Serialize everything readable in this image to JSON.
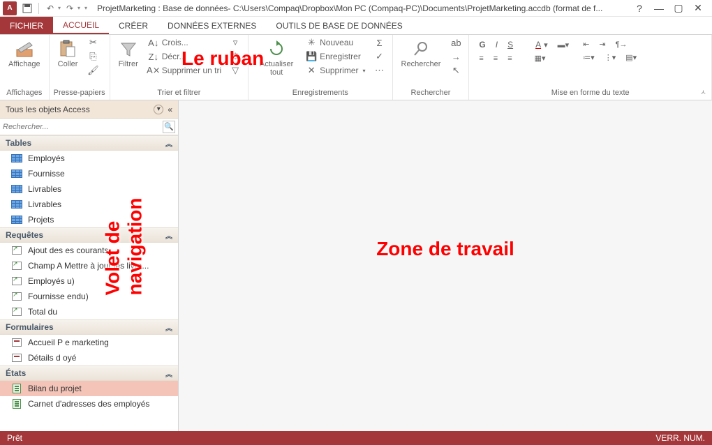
{
  "title": "ProjetMarketing : Base de données- C:\\Users\\Compaq\\Dropbox\\Mon PC (Compaq-PC)\\Documents\\ProjetMarketing.accdb (format de f...",
  "app_icon_letter": "A",
  "tabs": {
    "file": "FICHIER",
    "home": "ACCUEIL",
    "create": "CRÉER",
    "external": "DONNÉES EXTERNES",
    "dbtools": "OUTILS DE BASE DE DONNÉES"
  },
  "ribbon": {
    "views": {
      "label": "Affichages",
      "btn": "Affichage"
    },
    "clipboard": {
      "label": "Presse-papiers",
      "paste": "Coller"
    },
    "sortfilter": {
      "label": "Trier et filtrer",
      "filter": "Filtrer",
      "asc": "Crois...",
      "desc": "Décr...",
      "clear": "Supprimer un tri"
    },
    "records": {
      "label": "Enregistrements",
      "refresh": "Actualiser tout",
      "new": "Nouveau",
      "save": "Enregistrer",
      "delete": "Supprimer"
    },
    "find": {
      "label": "Rechercher",
      "btn": "Rechercher"
    },
    "textfmt": {
      "label": "Mise en forme du texte"
    }
  },
  "annotations": {
    "ribbon": "Le ruban",
    "nav": "Volet de navigation",
    "work": "Zone de travail"
  },
  "nav": {
    "title": "Tous les objets Access",
    "search_placeholder": "Rechercher...",
    "cats": {
      "tables": "Tables",
      "queries": "Requêtes",
      "forms": "Formulaires",
      "reports": "États"
    },
    "tables": [
      "Employés",
      "Fournisse",
      "Livrables",
      "Livrables",
      "Projets"
    ],
    "queries": [
      "Ajout des               es courants",
      "Champ A              Mettre à jour les livra...",
      "Employés             u)",
      "Fournisse           endu)",
      "Total du"
    ],
    "forms": [
      "Accueil P              e marketing",
      "Détails d              oyé"
    ],
    "reports": [
      "Bilan du projet",
      "Carnet d'adresses des employés"
    ]
  },
  "status": {
    "left": "Prêt",
    "right": "VERR. NUM."
  },
  "win": {
    "help": "?",
    "min": "—",
    "max": "▢",
    "close": "✕"
  }
}
